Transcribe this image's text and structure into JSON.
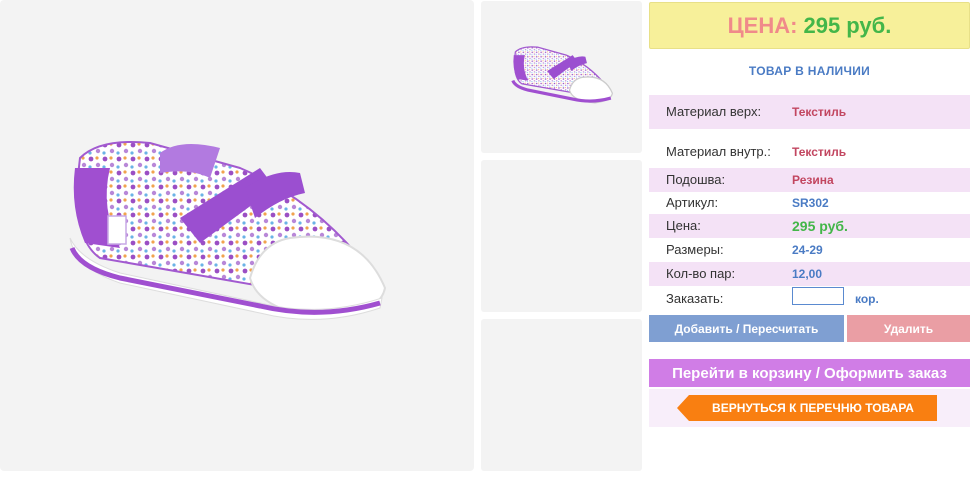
{
  "price_banner": {
    "label": "ЦЕНА:",
    "value": "295 руб."
  },
  "stock_status": "ТОВАР В НАЛИЧИИ",
  "specs": [
    {
      "label": "Материал верх:",
      "value": "Текстиль"
    },
    {
      "label": "Материал внутр.:",
      "value": "Текстиль"
    },
    {
      "label": "Подошва:",
      "value": "Резина"
    },
    {
      "label": "Артикул:",
      "value": "SR302"
    },
    {
      "label": "Цена:",
      "value": "295 руб."
    },
    {
      "label": "Размеры:",
      "value": "24-29"
    },
    {
      "label": "Кол-во пар:",
      "value": "12,00"
    }
  ],
  "order": {
    "label": "Заказать:",
    "value": "",
    "unit": "кор."
  },
  "buttons": {
    "add": "Добавить / Пересчитать",
    "delete": "Удалить",
    "cart": "Перейти в корзину / Оформить заказ",
    "back": "ВЕРНУТЬСЯ К ПЕРЕЧНЮ ТОВАРА"
  },
  "colors": {
    "price_banner_bg": "#f7f09a",
    "accent_pink": "#f4e2f6",
    "cart_button": "#d07de6",
    "back_button": "#f97f11"
  }
}
